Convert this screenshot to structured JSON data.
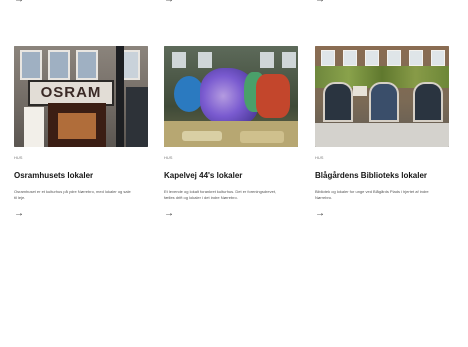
{
  "top_arrows": [
    "→",
    "→",
    "→"
  ],
  "cards": [
    {
      "tag": "HUS",
      "title": "Osramhusets lokaler",
      "description": "Osramhuset er et kulturhus på ydre Nørrebro, med lokaler og sale til leje.",
      "photo_sign": "OSRAM",
      "arrow": "→"
    },
    {
      "tag": "HUS",
      "title": "Kapelvej 44's lokaler",
      "description": "Et levende og lokalt forankret kulturhus. Det er foreningsdrevet, fælles drift og lokaler i det indre Nørrebro.",
      "arrow": "→"
    },
    {
      "tag": "HUS",
      "title": "Blågårdens Biblioteks lokaler",
      "description": "Bibliotek og lokaler for unge ved Blågårds Plads i hjertet af indre Nørrebro.",
      "arrow": "→"
    }
  ],
  "colors": {
    "title": "#161616",
    "text": "#555555",
    "tag": "#7a7a7a"
  }
}
